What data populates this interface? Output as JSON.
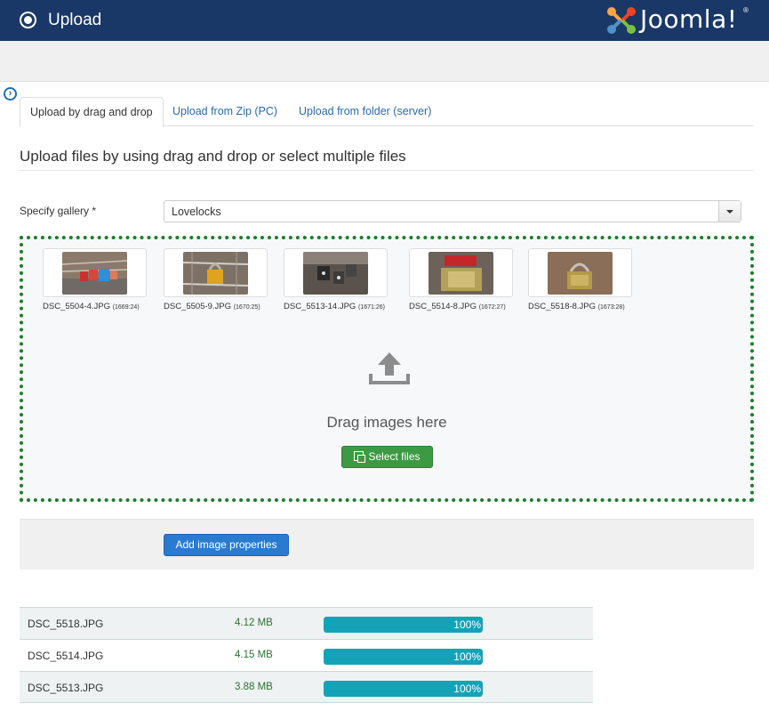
{
  "header": {
    "title": "Upload",
    "logo_text": "Joomla!",
    "logo_reg": "®"
  },
  "tabs": [
    {
      "label": "Upload by drag and drop",
      "active": true
    },
    {
      "label": "Upload from Zip (PC)",
      "active": false
    },
    {
      "label": "Upload from folder (server)",
      "active": false
    }
  ],
  "section": {
    "title": "Upload files by using drag and drop or select multiple files"
  },
  "gallery": {
    "label": "Specify gallery *",
    "value": "Lovelocks"
  },
  "dropzone": {
    "thumbnails": [
      {
        "name": "DSC_5504-4.JPG",
        "dims": "(1669:24)"
      },
      {
        "name": "DSC_5505-9.JPG",
        "dims": "(1670:25)"
      },
      {
        "name": "DSC_5513-14.JPG",
        "dims": "(1671:26)"
      },
      {
        "name": "DSC_5514-8.JPG",
        "dims": "(1672:27)"
      },
      {
        "name": "DSC_5518-8.JPG",
        "dims": "(1673:28)"
      }
    ],
    "drag_text": "Drag images here",
    "select_button": "Select files"
  },
  "properties": {
    "button": "Add image properties"
  },
  "files": [
    {
      "name": "DSC_5518.JPG",
      "size": "4.12 MB",
      "progress": 100,
      "progress_label": "100%"
    },
    {
      "name": "DSC_5514.JPG",
      "size": "4.15 MB",
      "progress": 100,
      "progress_label": "100%"
    },
    {
      "name": "DSC_5513.JPG",
      "size": "3.88 MB",
      "progress": 100,
      "progress_label": "100%"
    }
  ],
  "colors": {
    "header_bg": "#1a3867",
    "dropzone_border": "#1e7d2b",
    "progress": "#14a3b6",
    "primary_button": "#2a7bd0",
    "success_button": "#3c9a44"
  },
  "icons": {
    "header": "radio-target-icon",
    "toggle": "arrow-circle-right-icon",
    "upload": "upload-tray-icon",
    "select": "copy-icon"
  }
}
